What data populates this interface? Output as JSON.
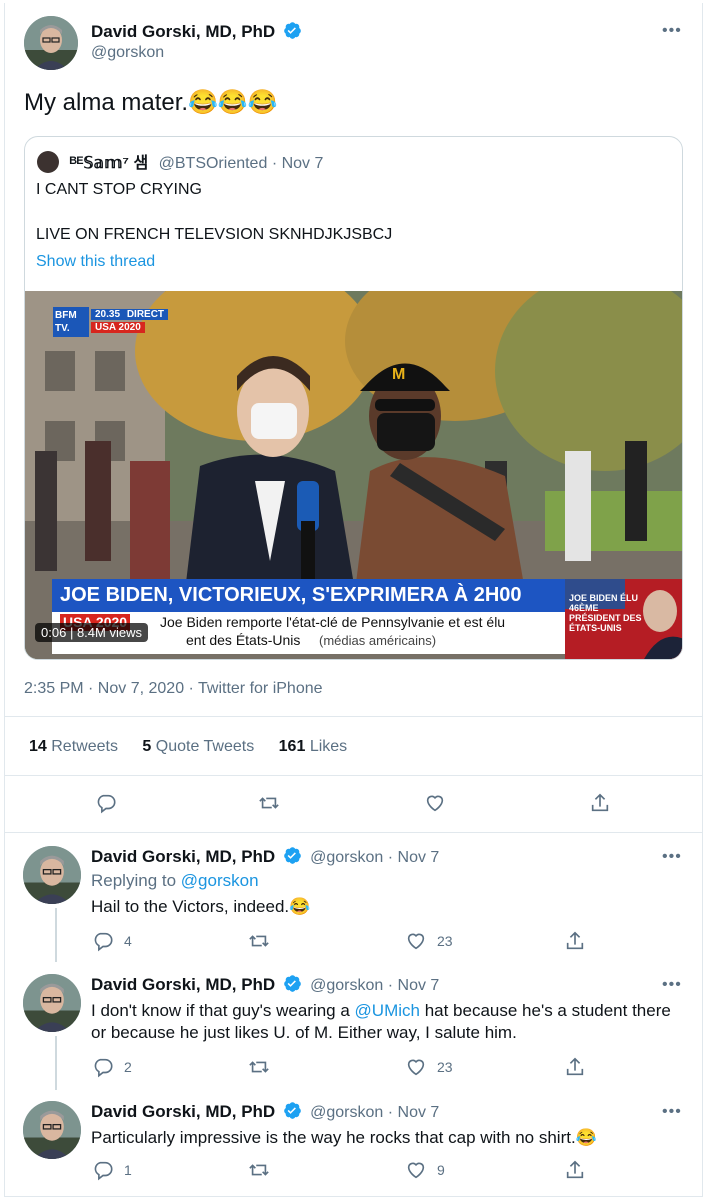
{
  "main_tweet": {
    "author_name": "David Gorski, MD, PhD",
    "handle": "@gorskon",
    "text": "My alma mater.😂😂😂",
    "quoted": {
      "author_name": "ᴮᴱ𝕊𝕒𝕞⁷ 샘",
      "handle": "@BTSOriented",
      "date": "Nov 7",
      "line1": "I CANT STOP CRYING",
      "line2": "LIVE ON FRENCH TELEVSION SKNHDJKJSBCJ",
      "show_thread": "Show this thread",
      "video": {
        "channel_logo": "BFM TV.",
        "time_badge": "20.35",
        "direct_badge": "DIRECT",
        "region_badge": "USA 2020",
        "headline": "JOE BIDEN, VICTORIEUX, S'EXPRIMERA À 2H00",
        "ticker_tag": "USA 2020",
        "ticker_line1": "Joe Biden remporte l'état-clé de Pennsylvanie et est élu",
        "ticker_line2": "ent des États-Unis",
        "ticker_source": "(médias américains)",
        "side_panel": "JOE BIDEN ÉLU 46ÈME PRÉSIDENT DES ÉTATS-UNIS",
        "duration": "0:06",
        "views": "8.4M views"
      }
    },
    "timestamp": "2:35 PM · Nov 7, 2020 · Twitter for iPhone",
    "stats": {
      "retweets_count": "14",
      "retweets_label": "Retweets",
      "quotes_count": "5",
      "quotes_label": "Quote Tweets",
      "likes_count": "161",
      "likes_label": "Likes"
    }
  },
  "replies": [
    {
      "author_name": "David Gorski, MD, PhD",
      "handle": "@gorskon",
      "date": "· Nov 7",
      "replying_prefix": "Replying to",
      "replying_to": "@gorskon",
      "text": "Hail to the Victors, indeed.😂",
      "reply_count": "4",
      "retweet_count": "",
      "like_count": "23"
    },
    {
      "author_name": "David Gorski, MD, PhD",
      "handle": "@gorskon",
      "date": "· Nov 7",
      "text_before": "I don't know if that guy's wearing a ",
      "mention": "@UMich",
      "text_after": " hat because he's a student there or because he just likes U. of M. Either way, I salute him.",
      "reply_count": "2",
      "retweet_count": "",
      "like_count": "23"
    },
    {
      "author_name": "David Gorski, MD, PhD",
      "handle": "@gorskon",
      "date": "· Nov 7",
      "text": "Particularly impressive is the way he rocks that cap with no shirt.😂",
      "reply_count": "1",
      "retweet_count": "",
      "like_count": "9"
    }
  ],
  "more_label": "•••",
  "icons": [
    "verified-badge-icon",
    "reply-icon",
    "retweet-icon",
    "like-icon",
    "share-icon",
    "more-icon"
  ],
  "colors": {
    "link": "#1b95e0",
    "secondary": "#5b7083",
    "verified": "#1da1f2"
  }
}
